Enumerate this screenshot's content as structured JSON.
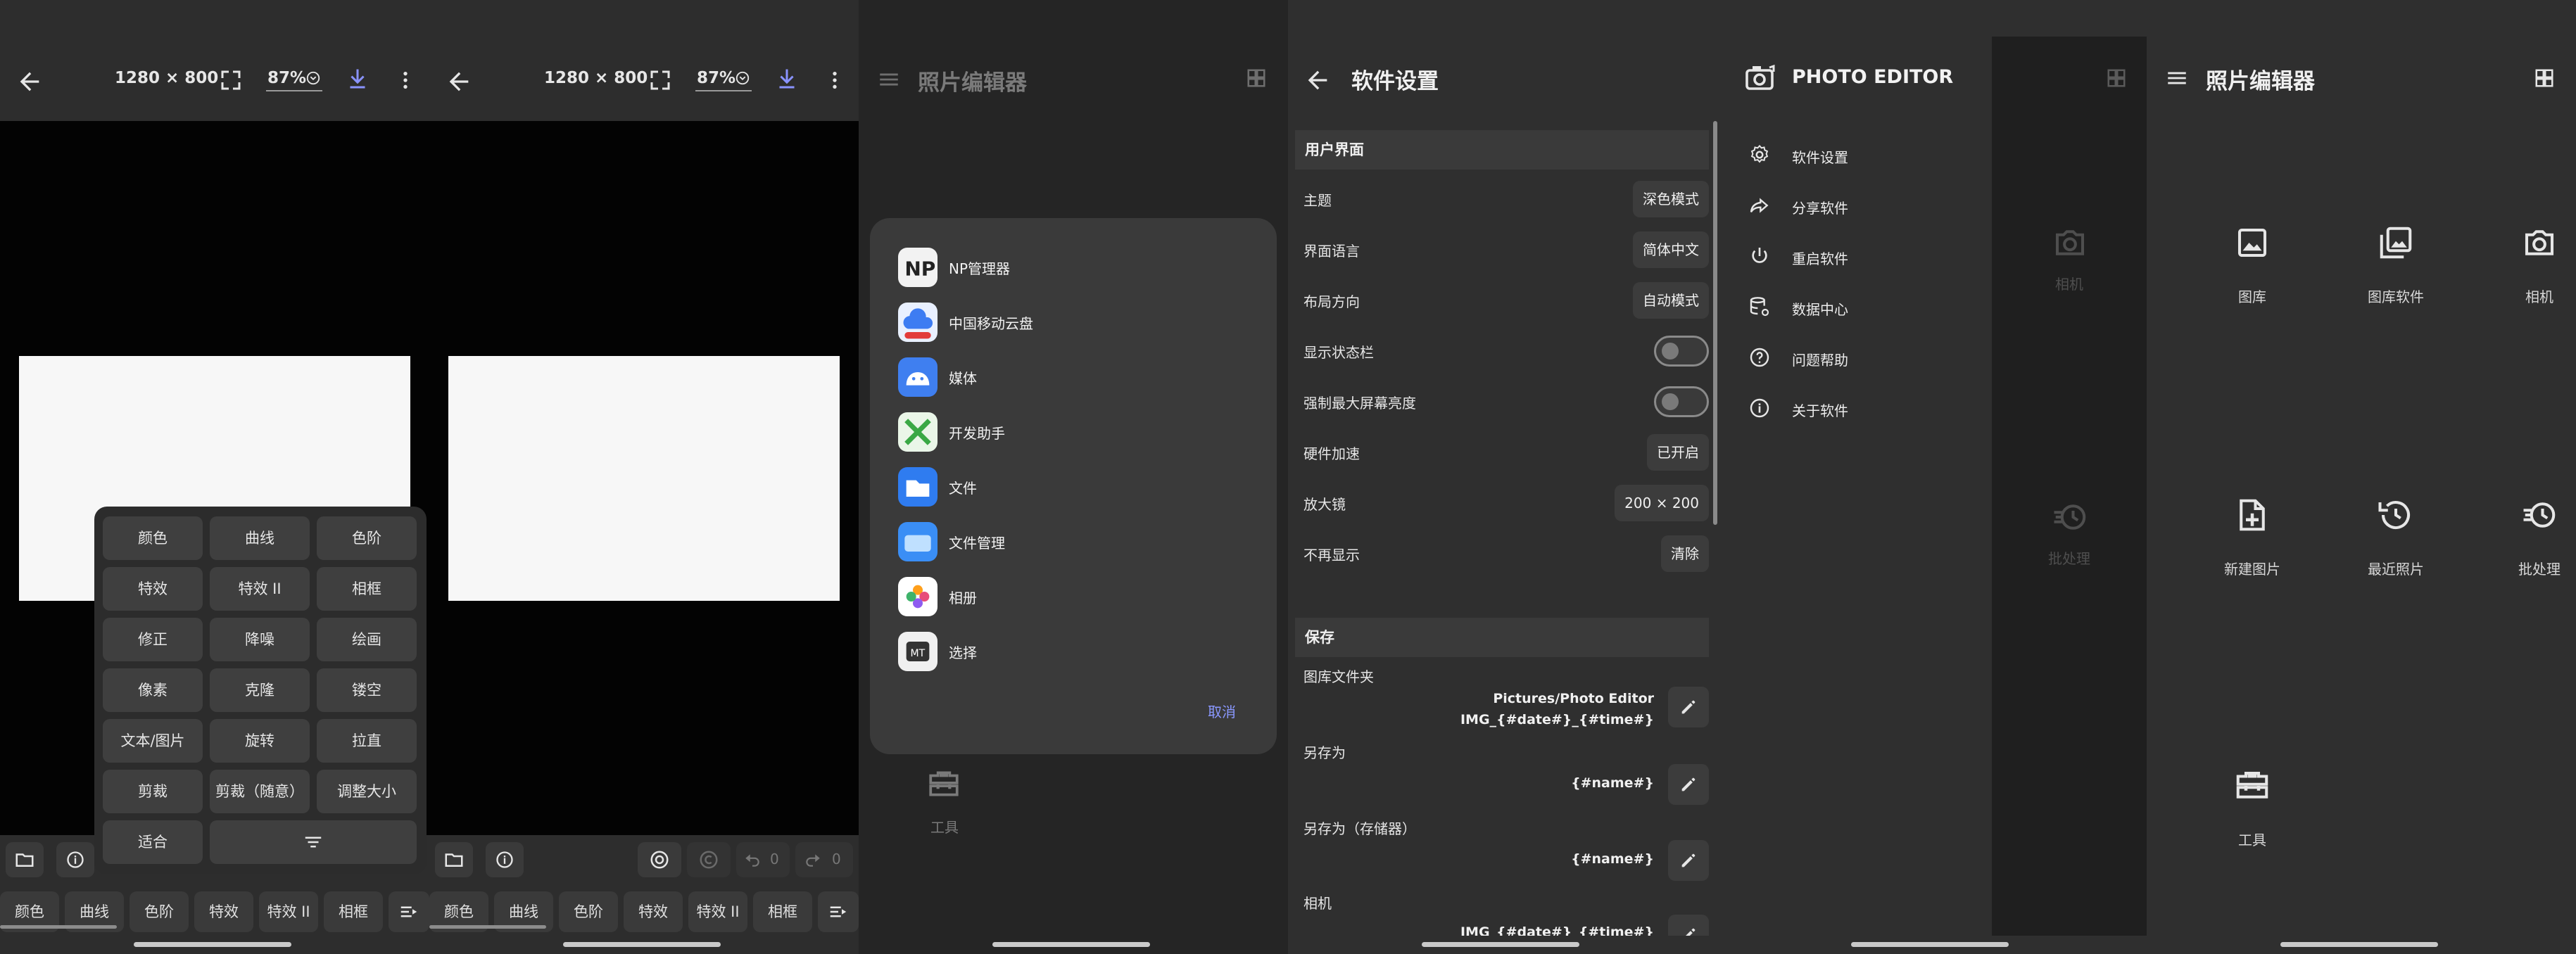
{
  "editor": {
    "resolution": "1280 × 800",
    "zoom": "87%",
    "undo_count": "0",
    "redo_count": "0",
    "bottom_tools": [
      "颜色",
      "曲线",
      "色阶",
      "特效",
      "特效 II",
      "相框"
    ],
    "popup_tools": [
      "颜色",
      "曲线",
      "色阶",
      "特效",
      "特效 II",
      "相框",
      "修正",
      "降噪",
      "绘画",
      "像素",
      "克隆",
      "镂空",
      "文本/图片",
      "旋转",
      "拉直",
      "剪裁",
      "剪裁（随意）",
      "调整大小",
      "适合"
    ]
  },
  "share_sheet": {
    "title": "照片编辑器",
    "apps": [
      {
        "label": "NP管理器",
        "icon": "np-manager-icon",
        "color": "#f2f2f2"
      },
      {
        "label": "中国移动云盘",
        "icon": "cloud-drive-icon",
        "color": "#e9f0ff"
      },
      {
        "label": "媒体",
        "icon": "media-icon",
        "color": "#3f7ff0"
      },
      {
        "label": "开发助手",
        "icon": "dev-assistant-icon",
        "color": "#eaf6e8"
      },
      {
        "label": "文件",
        "icon": "files-icon",
        "color": "#2f7cf0"
      },
      {
        "label": "文件管理",
        "icon": "file-manager-icon",
        "color": "#3a8ef5"
      },
      {
        "label": "相册",
        "icon": "gallery-icon",
        "color": "#ffffff"
      },
      {
        "label": "选择",
        "icon": "mt-select-icon",
        "color": "#f0f0f0"
      }
    ],
    "cancel": "取消",
    "tools_label": "工具"
  },
  "settings": {
    "title": "软件设置",
    "section_ui": "用户界面",
    "rows": [
      {
        "label": "主题",
        "value": "深色模式"
      },
      {
        "label": "界面语言",
        "value": "简体中文"
      },
      {
        "label": "布局方向",
        "value": "自动模式"
      },
      {
        "label": "显示状态栏",
        "toggle": false
      },
      {
        "label": "强制最大屏幕亮度",
        "toggle": false
      },
      {
        "label": "硬件加速",
        "value": "已开启"
      },
      {
        "label": "放大镜",
        "value": "200 × 200"
      },
      {
        "label": "不再显示",
        "value": "清除"
      }
    ],
    "section_save": "保存",
    "save_rows": [
      {
        "label": "图库文件夹",
        "line1": "Pictures/Photo Editor",
        "line2": "IMG_{#date#}_{#time#}"
      },
      {
        "label": "另存为",
        "line1": "{#name#}"
      },
      {
        "label": "另存为（存储器）",
        "line1": "{#name#}"
      },
      {
        "label": "相机",
        "line1": "IMG_{#date#}_{#time#}"
      }
    ]
  },
  "drawer": {
    "brand": "PHOTO EDITOR",
    "items": [
      {
        "label": "软件设置",
        "icon": "gear-icon"
      },
      {
        "label": "分享软件",
        "icon": "share-icon"
      },
      {
        "label": "重启软件",
        "icon": "power-icon"
      },
      {
        "label": "数据中心",
        "icon": "database-icon"
      },
      {
        "label": "问题帮助",
        "icon": "help-icon"
      },
      {
        "label": "关于软件",
        "icon": "info-icon"
      }
    ],
    "dim_labels": [
      "相机",
      "批处理"
    ]
  },
  "home": {
    "title": "照片编辑器",
    "tiles": [
      {
        "label": "图库",
        "icon": "image-icon"
      },
      {
        "label": "图库软件",
        "icon": "gallery-app-icon"
      },
      {
        "label": "相机",
        "icon": "camera-icon"
      },
      {
        "label": "新建图片",
        "icon": "new-image-icon"
      },
      {
        "label": "最近照片",
        "icon": "history-icon"
      },
      {
        "label": "批处理",
        "icon": "batch-icon"
      },
      {
        "label": "工具",
        "icon": "toolbox-icon"
      }
    ]
  }
}
